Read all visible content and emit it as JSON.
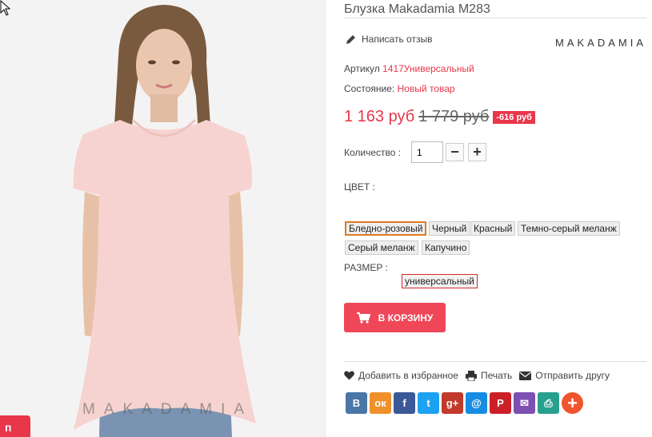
{
  "product": {
    "title": "Блузка Makadamia M283",
    "review_label": "Написать отзыв",
    "brand": "MAKADAMIA",
    "article_label": "Артикул",
    "article_value": "1417Универсальный",
    "condition_label": "Состояние:",
    "condition_value": "Новый товар",
    "price_new": "1 163 руб",
    "price_old": "1 779 руб",
    "discount": "-616 руб"
  },
  "quantity": {
    "label": "Количество :",
    "value": "1",
    "minus": "−",
    "plus": "+"
  },
  "color": {
    "label": "ЦВЕТ :",
    "options": [
      "Бледно-розовый",
      "Черный",
      "Красный",
      "Темно-серый меланж",
      "Серый меланж",
      "Капучино"
    ],
    "selected": "Бледно-розовый"
  },
  "size": {
    "label": "РАЗМЕР :",
    "options": [
      "универсальный"
    ],
    "selected": "универсальный"
  },
  "cart": {
    "label": "В КОРЗИНУ",
    "icon": "cart-icon"
  },
  "actions": {
    "wishlist": "Добавить в избранное",
    "print": "Печать",
    "send": "Отправить другу"
  },
  "share": {
    "buttons": [
      {
        "glyph": "В",
        "icon": "vk-icon",
        "color": "#4a76a8"
      },
      {
        "glyph": "ок",
        "icon": "odnoklassniki-icon",
        "color": "#f0902a"
      },
      {
        "glyph": "f",
        "icon": "facebook-icon",
        "color": "#3b5998"
      },
      {
        "glyph": "t",
        "icon": "twitter-icon",
        "color": "#1da1f2"
      },
      {
        "glyph": "g+",
        "icon": "google-plus-icon",
        "color": "#c1392b"
      },
      {
        "glyph": "@",
        "icon": "mail-ru-icon",
        "color": "#168de2"
      },
      {
        "glyph": "P",
        "icon": "pinterest-icon",
        "color": "#cb2027"
      },
      {
        "glyph": "✉",
        "icon": "email-icon",
        "color": "#7d4fb2"
      },
      {
        "glyph": "⎙",
        "icon": "print-share-icon",
        "color": "#27a08d"
      },
      {
        "glyph": "+",
        "icon": "more-share-icon",
        "color": "#f0552f"
      }
    ]
  },
  "photo": {
    "watermark": "MAKADAMIA",
    "corner_badge": "п"
  },
  "colors": {
    "accent": "#e8364a",
    "button": "#ef4758",
    "selected_color_border": "#e07a23"
  }
}
